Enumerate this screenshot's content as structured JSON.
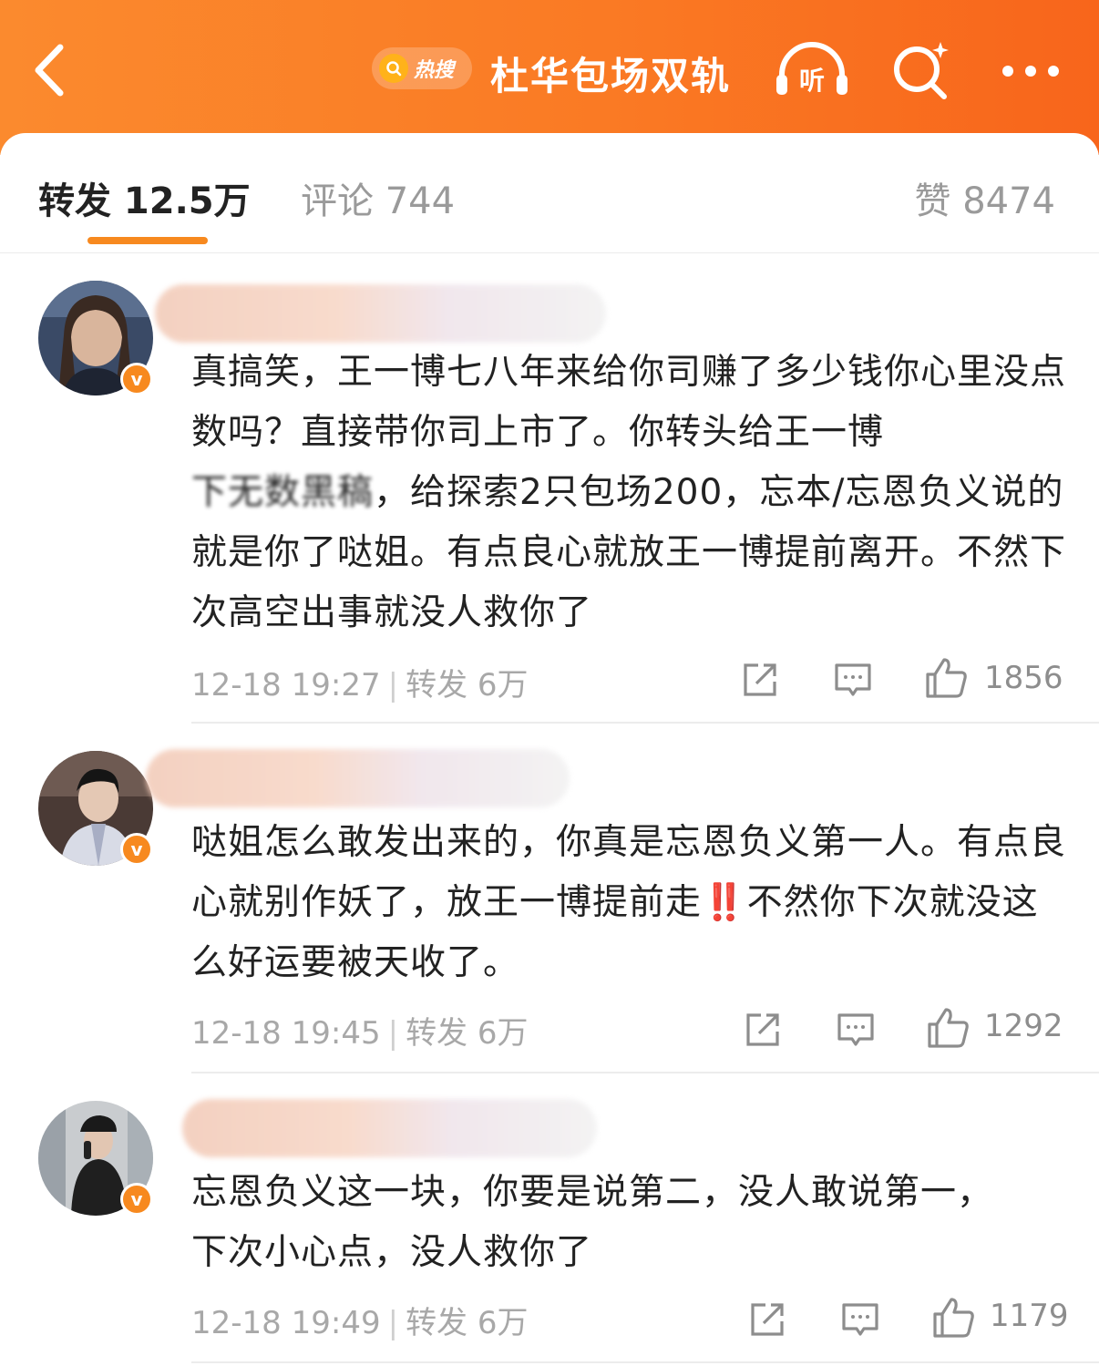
{
  "header": {
    "hot_badge": "热搜",
    "topic_title": "杜华包场双轨",
    "listen_label": "听"
  },
  "tabs": {
    "repost": "转发 12.5万",
    "comments": "评论 744",
    "likes": "赞 8474"
  },
  "comments": [
    {
      "username": "",
      "text_a": "真搞笑，王一博七八年来给你司赚了多少钱你心里没点数吗？直接带你司上市了。你转头给王一博",
      "text_redacted": "下无数黑稿",
      "text_b": "，给探索2只包场200，忘本/忘恩负义说的就是你了哒姐。有点良心就放王一博提前离开。不然下次高空出事就没人救你了",
      "time": "12-18 19:27",
      "repost": "转发 6万",
      "likes": "1856"
    },
    {
      "username": "",
      "text_a": "哒姐怎么敢发出来的，你真是忘恩负义第一人。有点良心就别作妖了，放王一博提前走",
      "text_emoji": "‼️",
      "text_b": "不然你下次就没这么好运要被天收了。",
      "time": "12-18 19:45",
      "repost": "转发 6万",
      "likes": "1292"
    },
    {
      "username": "",
      "text_a": "忘恩负义这一块，你要是说第二，没人敢说第一，下次小心点，没人救你了",
      "time": "12-18 19:49",
      "repost": "转发 6万",
      "likes": "1179"
    }
  ],
  "colors": {
    "header_orange": "#fa7a24",
    "accent": "#f7891f",
    "muted_text": "#a8a8a8"
  },
  "icons": [
    "back-icon",
    "search-icon",
    "listen-icon",
    "more-icon",
    "share-icon",
    "comment-icon",
    "like-icon",
    "verified-icon"
  ]
}
